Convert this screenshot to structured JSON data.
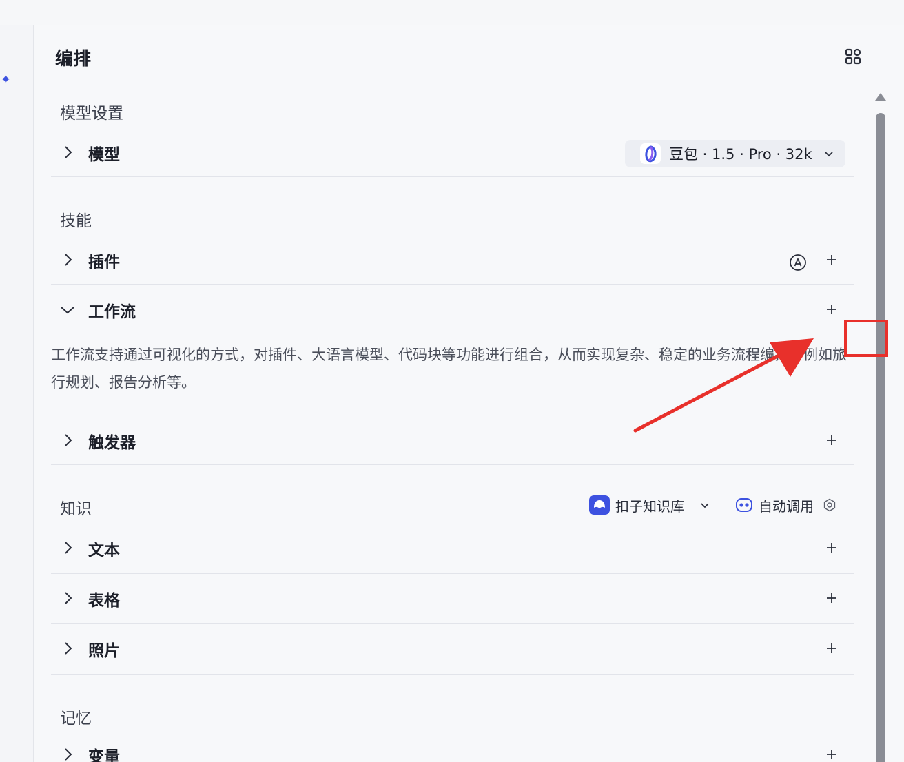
{
  "panel": {
    "title": "编排"
  },
  "sections": {
    "model_settings": "模型设置",
    "skills": "技能",
    "knowledge": "知识",
    "memory": "记忆"
  },
  "rows": {
    "model": "模型",
    "plugin": "插件",
    "workflow": "工作流",
    "trigger": "触发器",
    "text": "文本",
    "table": "表格",
    "photo": "照片",
    "variable": "变量"
  },
  "model_selector": {
    "value": "豆包 · 1.5 · Pro · 32k"
  },
  "workflow_description": "工作流支持通过可视化的方式，对插件、大语言模型、代码块等功能进行组合，从而实现复杂、稳定的业务流程编排，例如旅行规划、报告分析等。",
  "knowledge_controls": {
    "kb_select": "扣子知识库",
    "auto_call": "自动调用"
  },
  "colors": {
    "accent": "#3d52e0",
    "annotation": "#e8302b",
    "text_primary": "#1c1f29",
    "divider": "#e2e4ea"
  }
}
